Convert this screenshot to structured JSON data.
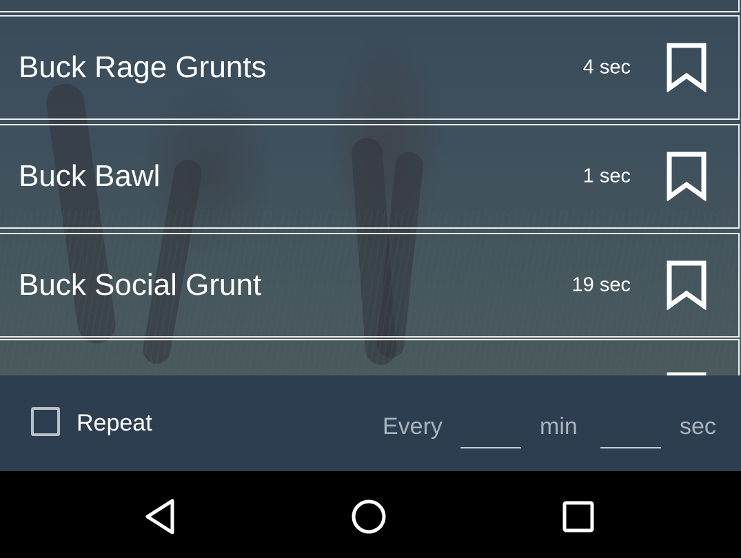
{
  "sounds": [
    {
      "title": "",
      "duration": ""
    },
    {
      "title": "Buck Rage Grunts",
      "duration": "4 sec"
    },
    {
      "title": "Buck Bawl",
      "duration": "1 sec"
    },
    {
      "title": "Buck Social Grunt",
      "duration": "19 sec"
    },
    {
      "title": "",
      "duration": ""
    }
  ],
  "repeat": {
    "label": "Repeat",
    "checked": false,
    "every_label": "Every",
    "min_label": "min",
    "sec_label": "sec",
    "min_value": "",
    "sec_value": ""
  },
  "icons": {
    "bookmark": "bookmark-outline-icon",
    "back": "nav-back-icon",
    "home": "nav-home-icon",
    "recents": "nav-recents-icon"
  },
  "colors": {
    "bottom_bar": "#2d3e50",
    "overlay": "#2c3e52",
    "text": "#ffffff",
    "muted_text": "#a9b4bd"
  }
}
